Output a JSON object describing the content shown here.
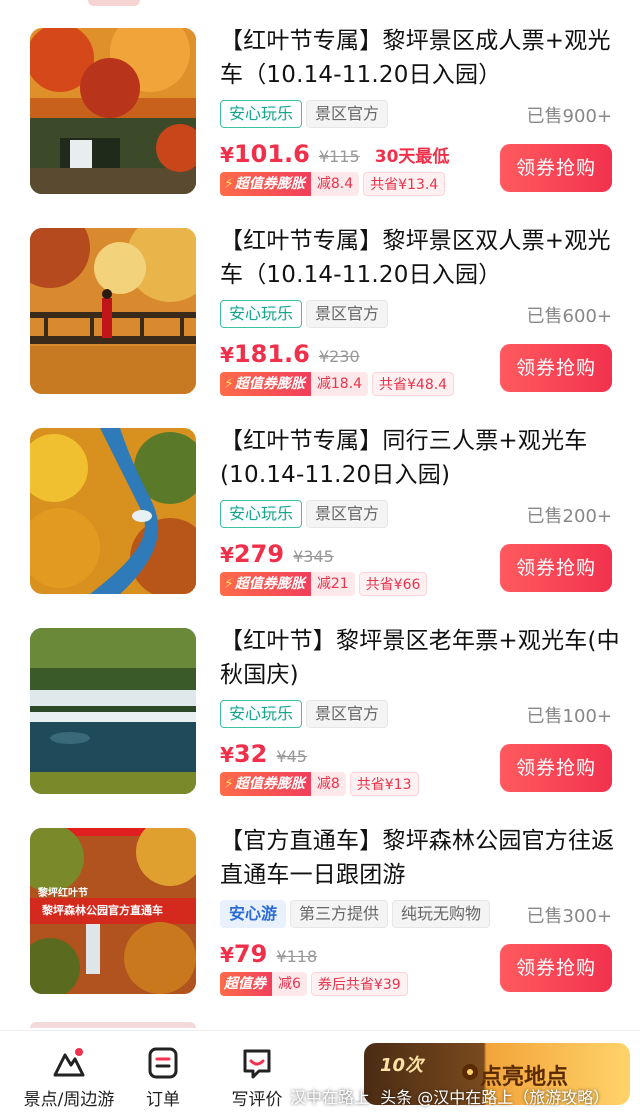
{
  "products": [
    {
      "title": "【红叶节专属】黎坪景区成人票+观光车（10.14-11.20日入园）",
      "tags": [
        {
          "text": "安心玩乐",
          "style": "green"
        },
        {
          "text": "景区官方",
          "style": "gray"
        }
      ],
      "sold": "已售900+",
      "price_currency": "¥",
      "price": "101.6",
      "original_price": "¥115",
      "price_note": "30天最低",
      "promo_label": "超值券膨胀",
      "promo_value": "减8.4",
      "save_text": "共省¥13.4",
      "buy_label": "领券抢购",
      "image_icon": "waterfall-autumn-photo"
    },
    {
      "title": "【红叶节专属】黎坪景区双人票+观光车（10.14-11.20日入园）",
      "tags": [
        {
          "text": "安心玩乐",
          "style": "green"
        },
        {
          "text": "景区官方",
          "style": "gray"
        }
      ],
      "sold": "已售600+",
      "price_currency": "¥",
      "price": "181.6",
      "original_price": "¥230",
      "price_note": "",
      "promo_label": "超值券膨胀",
      "promo_value": "减18.4",
      "save_text": "共省¥48.4",
      "buy_label": "领券抢购",
      "image_icon": "bridge-autumn-photo"
    },
    {
      "title": "【红叶节专属】同行三人票+观光车(10.14-11.20日入园)",
      "tags": [
        {
          "text": "安心玩乐",
          "style": "green"
        },
        {
          "text": "景区官方",
          "style": "gray"
        }
      ],
      "sold": "已售200+",
      "price_currency": "¥",
      "price": "279",
      "original_price": "¥345",
      "price_note": "",
      "promo_label": "超值券膨胀",
      "promo_value": "减21",
      "save_text": "共省¥66",
      "buy_label": "领券抢购",
      "image_icon": "river-aerial-photo"
    },
    {
      "title": "【红叶节】黎坪景区老年票+观光车(中秋国庆)",
      "tags": [
        {
          "text": "安心玩乐",
          "style": "green"
        },
        {
          "text": "景区官方",
          "style": "gray"
        }
      ],
      "sold": "已售100+",
      "price_currency": "¥",
      "price": "32",
      "original_price": "¥45",
      "price_note": "",
      "promo_label": "超值券膨胀",
      "promo_value": "减8",
      "save_text": "共省¥13",
      "buy_label": "领券抢购",
      "image_icon": "cascade-pools-photo"
    },
    {
      "title": "【官方直通车】黎坪森林公园官方往返直通车一日跟团游",
      "tags": [
        {
          "text": "安心游",
          "style": "blue"
        },
        {
          "text": "第三方提供",
          "style": "gray"
        },
        {
          "text": "纯玩无购物",
          "style": "gray"
        }
      ],
      "sold": "已售300+",
      "price_currency": "¥",
      "price": "79",
      "original_price": "¥118",
      "price_note": "",
      "promo_label": "超值券",
      "promo_value": "减6",
      "save_text": "券后共省¥39",
      "buy_label": "领券抢购",
      "image_icon": "forest-waterfall-poster",
      "image_caption_top": "黎坪红叶节",
      "image_caption_main": "黎坪森林公园官方直通车"
    }
  ],
  "nav": {
    "items": [
      {
        "label": "景点/周边游",
        "icon": "mountain-icon"
      },
      {
        "label": "订单",
        "icon": "order-icon"
      },
      {
        "label": "写评价",
        "icon": "review-icon"
      }
    ],
    "banner_left": "10次",
    "banner_right": "点亮地点"
  },
  "watermark": {
    "left": "汉中在路上",
    "right": "头条 @汉中在路上（旅游攻略）"
  }
}
